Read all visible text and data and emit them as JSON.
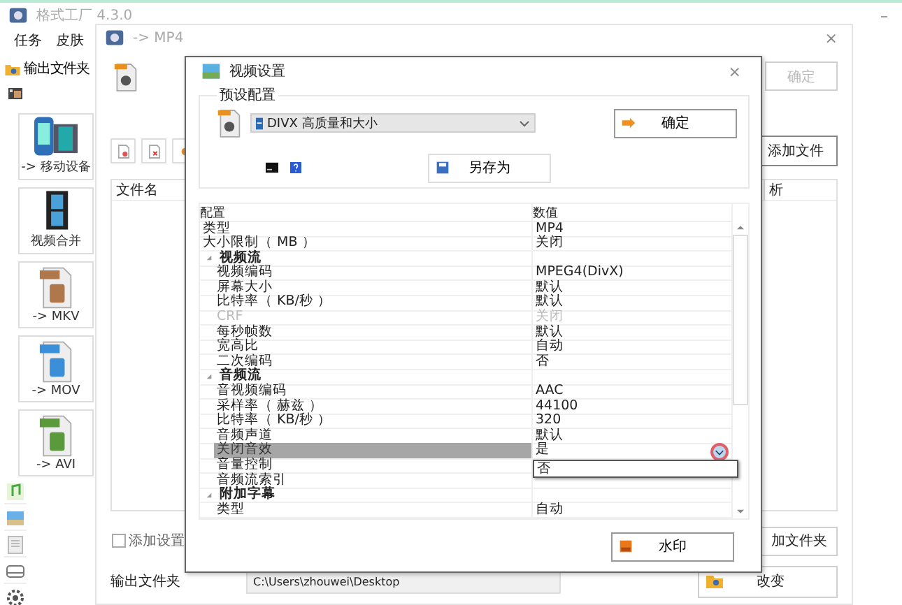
{
  "main_window": {
    "title": "格式工厂 4.3.0",
    "minimize": "–",
    "menu": [
      "任务",
      "皮肤"
    ],
    "output_folder_button": "输出文件夹",
    "categories": [
      {
        "label": "-> 移动设备",
        "kind": "mobile"
      },
      {
        "label": "视频合并",
        "kind": "film"
      },
      {
        "label": "-> MKV",
        "kind": "mkv"
      },
      {
        "label": "-> MOV",
        "kind": "mov"
      },
      {
        "label": "-> AVI",
        "kind": "avi"
      }
    ]
  },
  "mp4_dialog": {
    "title": "-> MP4",
    "close": "×",
    "ok_button": {
      "label": "确定",
      "disabled": true
    },
    "add_file_button": "添加文件",
    "file_list": {
      "columns": [
        "文件名",
        "析"
      ]
    },
    "add_setting_name": {
      "label": "添加设置",
      "checked": false
    },
    "add_folder_button": "加文件夹",
    "output_folder_label": "输出文件夹",
    "output_folder_value": "C:\\Users\\zhouwei\\Desktop",
    "change_button": "改变"
  },
  "video_settings": {
    "title": "视频设置",
    "close": "×",
    "preset_group": "预设配置",
    "preset_value": "DIVX 高质量和大小",
    "ok_button": "确定",
    "save_as_button": "另存为",
    "grid": {
      "columns": [
        "配置",
        "数值"
      ],
      "rows": [
        {
          "kind": "item",
          "label": "类型",
          "value": "MP4",
          "disabled": false,
          "selected": false
        },
        {
          "kind": "item",
          "label": "大小限制（ MB ）",
          "value": "关闭",
          "disabled": false,
          "selected": false
        },
        {
          "kind": "category",
          "label": "视频流",
          "expanded": true,
          "children": [
            {
              "kind": "item",
              "label": "视频编码",
              "value": "MPEG4(DivX)",
              "disabled": false,
              "selected": false
            },
            {
              "kind": "item",
              "label": "屏幕大小",
              "value": "默认",
              "disabled": false,
              "selected": false
            },
            {
              "kind": "item",
              "label": "比特率（ KB/秒 ）",
              "value": "默认",
              "disabled": false,
              "selected": false
            },
            {
              "kind": "item",
              "label": "CRF",
              "value": "关闭",
              "disabled": true,
              "selected": false
            },
            {
              "kind": "item",
              "label": "每秒帧数",
              "value": "默认",
              "disabled": false,
              "selected": false
            },
            {
              "kind": "item",
              "label": "宽高比",
              "value": "自动",
              "disabled": false,
              "selected": false
            },
            {
              "kind": "item",
              "label": "二次编码",
              "value": "否",
              "disabled": false,
              "selected": false
            }
          ]
        },
        {
          "kind": "category",
          "label": "音频流",
          "expanded": true,
          "children": [
            {
              "kind": "item",
              "label": "音视频编码",
              "value": "AAC",
              "disabled": false,
              "selected": false
            },
            {
              "kind": "item",
              "label": "采样率（ 赫兹 ）",
              "value": "44100",
              "disabled": false,
              "selected": false
            },
            {
              "kind": "item",
              "label": "比特率（ KB/秒 ）",
              "value": "320",
              "disabled": false,
              "selected": false
            },
            {
              "kind": "item",
              "label": "音频声道",
              "value": "默认",
              "disabled": false,
              "selected": false
            },
            {
              "kind": "item",
              "label": "关闭音效",
              "value": "是",
              "disabled": false,
              "selected": true
            },
            {
              "kind": "item",
              "label": "音量控制",
              "disabled": false,
              "selected": false
            },
            {
              "kind": "item",
              "label": "音频流索引",
              "disabled": false,
              "selected": false
            }
          ]
        },
        {
          "kind": "category",
          "label": "附加字幕",
          "expanded": true,
          "children": [
            {
              "kind": "item",
              "label": "类型",
              "value": "自动",
              "disabled": false,
              "selected": false
            }
          ]
        }
      ]
    },
    "dropdown_options": [
      "否"
    ],
    "watermark_button": "水印"
  }
}
